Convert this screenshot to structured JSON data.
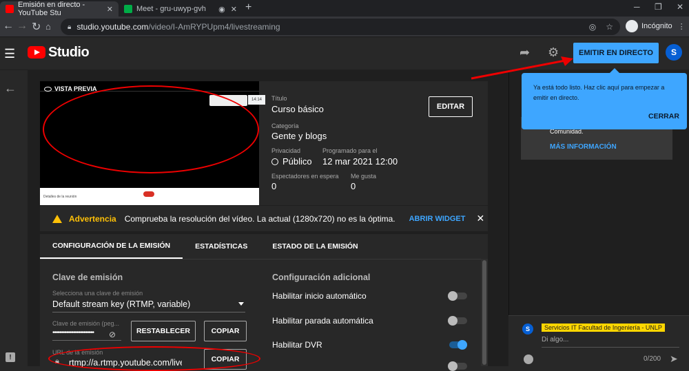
{
  "browser": {
    "tabs": [
      {
        "title": "Emisión en directo - YouTube Stu",
        "favicon_color": "#ff0000"
      },
      {
        "title": "Meet - gru-uwyp-gvh",
        "favicon_color": "#00ac47"
      }
    ],
    "url_host": "studio.youtube.com",
    "url_path": "/video/I-AmRYPUpm4/livestreaming",
    "mode_label": "Incógnito"
  },
  "header": {
    "logo_text": "Studio",
    "go_live_label": "EMITIR EN DIRECTO",
    "avatar_letter": "S"
  },
  "preview": {
    "label": "VISTA PREVIA",
    "meet_detail": "Detalles de la reunión",
    "meet_chip": "14:14"
  },
  "details": {
    "title_label": "Título",
    "title_value": "Curso básico",
    "edit_label": "EDITAR",
    "category_label": "Categoría",
    "category_value": "Gente y blogs",
    "privacy_label": "Privacidad",
    "privacy_value": "Público",
    "scheduled_label": "Programado para el",
    "scheduled_value": "12 mar 2021 12:00",
    "waiting_label": "Espectadores en espera",
    "waiting_value": "0",
    "likes_label": "Me gusta",
    "likes_value": "0"
  },
  "warning": {
    "title": "Advertencia",
    "message": "Comprueba la resolución del vídeo. La actual (1280x720) no es la óptima.",
    "link": "ABRIR WIDGET",
    "close": "✕"
  },
  "tabs": [
    "CONFIGURACIÓN DE LA EMISIÓN",
    "ESTADÍSTICAS",
    "ESTADO DE LA EMISIÓN"
  ],
  "stream_key": {
    "heading": "Clave de emisión",
    "select_label": "Selecciona una clave de emisión",
    "select_value": "Default stream key (RTMP, variable)",
    "key_label": "Clave de emisión (peg...",
    "key_value": "••••••••••••••••••••••••",
    "reset_label": "RESTABLECER",
    "copy_label": "COPIAR",
    "url_label": "URL de la emisión",
    "url_value": "rtmp://a.rtmp.youtube.com/live",
    "copy2_label": "COPIAR"
  },
  "additional": {
    "heading": "Configuración adicional",
    "toggles": [
      {
        "label": "Habilitar inicio automático",
        "on": false
      },
      {
        "label": "Habilitar parada automática",
        "on": false
      },
      {
        "label": "Habilitar DVR",
        "on": true
      }
    ]
  },
  "tooltip": {
    "text": "Ya está todo listo. Haz clic aquí para empezar a emitir en directo.",
    "close_label": "CERRAR"
  },
  "chat": {
    "info_text": "Comunidad.",
    "more_label": "MÁS INFORMACIÓN",
    "user_name": "Servicios IT Facultad de Ingeniería - UNLP",
    "placeholder": "Di algo...",
    "counter": "0/200",
    "avatar_letter": "S"
  },
  "colors": {
    "accent": "#3ea6ff",
    "warning": "#ffc107",
    "annotation": "#ee0000"
  }
}
